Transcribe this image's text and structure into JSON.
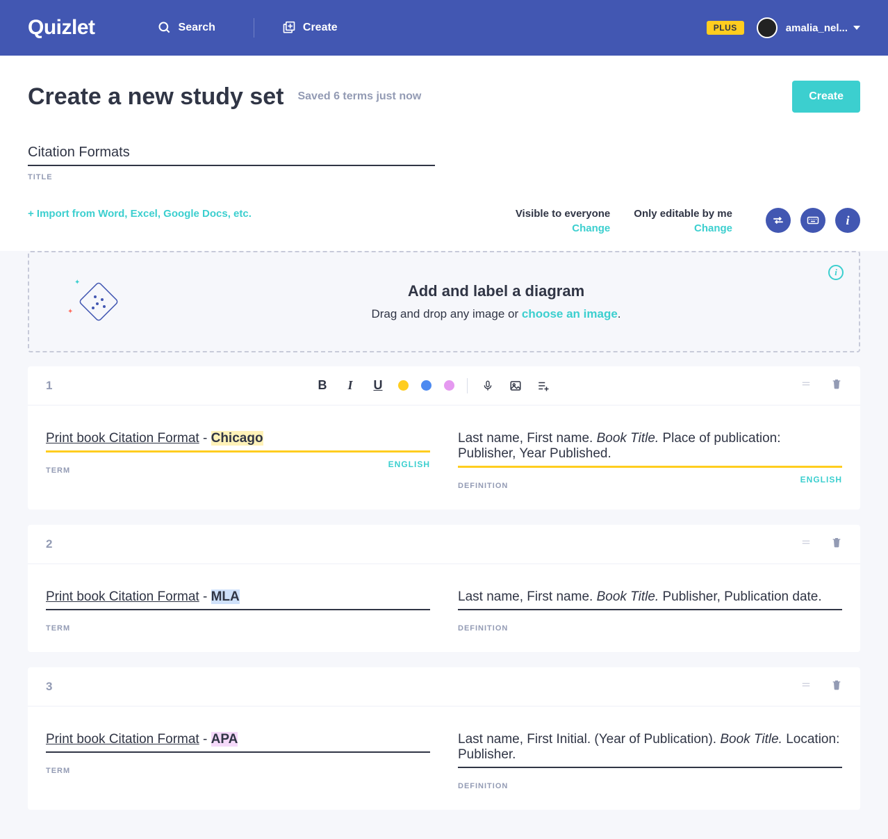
{
  "header": {
    "logo": "Quizlet",
    "search": "Search",
    "create": "Create",
    "plus": "PLUS",
    "username": "amalia_nel..."
  },
  "page": {
    "title": "Create a new study set",
    "saved": "Saved 6 terms just now",
    "create_btn": "Create",
    "set_title": "Citation Formats",
    "title_label": "TITLE",
    "import": "+ Import from Word, Excel, Google Docs, etc.",
    "vis_label": "Visible to everyone",
    "edit_label": "Only editable by me",
    "change": "Change"
  },
  "diagram": {
    "title": "Add and label a diagram",
    "sub_a": "Drag and drop any image or ",
    "choose": "choose an image",
    "sub_b": "."
  },
  "labels": {
    "term": "TERM",
    "definition": "DEFINITION",
    "english": "ENGLISH"
  },
  "cards": [
    {
      "n": "1",
      "term_parts": [
        {
          "t": "Print book Citation Format",
          "ul": true
        },
        {
          "t": " - "
        },
        {
          "t": "Chicago",
          "b": true,
          "hl": "y"
        }
      ],
      "def_parts": [
        {
          "t": "Last name, First name. "
        },
        {
          "t": "Book Title.",
          "it": true
        },
        {
          "t": " Place of publication: Publisher, Year Published."
        }
      ],
      "toolbar": true,
      "term_hl": true,
      "def_hl": true,
      "show_lang": true
    },
    {
      "n": "2",
      "term_parts": [
        {
          "t": "Print book Citation Format",
          "ul": true
        },
        {
          "t": " - "
        },
        {
          "t": "MLA",
          "b": true,
          "hl": "b"
        }
      ],
      "def_parts": [
        {
          "t": "Last name, First name. "
        },
        {
          "t": "Book Title.",
          "it": true
        },
        {
          "t": " Publisher, Publication date."
        }
      ]
    },
    {
      "n": "3",
      "term_parts": [
        {
          "t": "Print book Citation Format",
          "ul": true
        },
        {
          "t": " - "
        },
        {
          "t": "APA",
          "b": true,
          "hl": "p"
        }
      ],
      "def_parts": [
        {
          "t": "Last name, First Initial. (Year of Publication). "
        },
        {
          "t": "Book Title.",
          "it": true
        },
        {
          "t": " Location: Publisher."
        }
      ]
    }
  ]
}
